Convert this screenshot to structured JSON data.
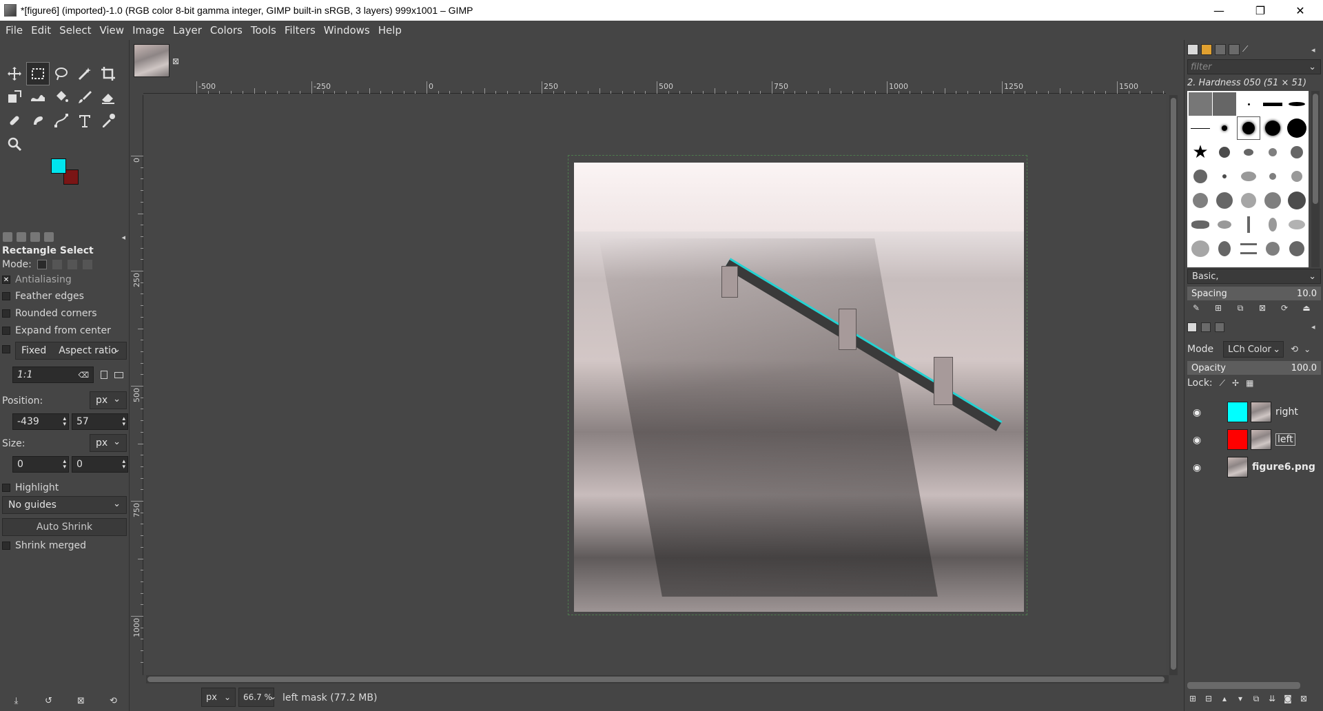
{
  "window": {
    "title": "*[figure6] (imported)-1.0 (RGB color 8-bit gamma integer, GIMP built-in sRGB, 3 layers) 999x1001 – GIMP",
    "minimize": "—",
    "maximize": "❐",
    "close": "✕"
  },
  "menu": [
    "File",
    "Edit",
    "Select",
    "View",
    "Image",
    "Layer",
    "Colors",
    "Tools",
    "Filters",
    "Windows",
    "Help"
  ],
  "colors": {
    "foreground": "#00e5ee",
    "background": "#7a1515"
  },
  "tool_options": {
    "title": "Rectangle Select",
    "mode_label": "Mode:",
    "antialiasing": "Antialiasing",
    "feather_edges": "Feather edges",
    "rounded_corners": "Rounded corners",
    "expand_from_center": "Expand from center",
    "fixed": "Fixed",
    "fixed_mode": "Aspect ratio",
    "ratio": "1:1",
    "position_label": "Position:",
    "position_unit": "px",
    "position_x": "-439",
    "position_y": "57",
    "size_label": "Size:",
    "size_unit": "px",
    "size_w": "0",
    "size_h": "0",
    "highlight": "Highlight",
    "guides": "No guides",
    "auto_shrink": "Auto Shrink",
    "shrink_merged": "Shrink merged"
  },
  "ruler": {
    "h_labels": [
      "-500",
      "-250",
      "0",
      "250",
      "500",
      "750",
      "1000",
      "1250",
      "1500"
    ],
    "v_labels": [
      "0",
      "250",
      "500",
      "750",
      "1000"
    ]
  },
  "status": {
    "unit": "px",
    "zoom": "66.7 %",
    "message": "left mask (77.2 MB)"
  },
  "brushes": {
    "filter_placeholder": "filter",
    "current": "2. Hardness 050 (51 × 51)",
    "preset": "Basic,",
    "spacing_label": "Spacing",
    "spacing_value": "10.0"
  },
  "layers": {
    "mode_label": "Mode",
    "mode_value": "LCh Color",
    "opacity_label": "Opacity",
    "opacity_value": "100.0",
    "lock_label": "Lock:",
    "items": [
      {
        "name": "right",
        "mask_color": "#00ffff",
        "has_mask": true
      },
      {
        "name": "left",
        "mask_color": "#ff0000",
        "has_mask": true
      },
      {
        "name": "figure6.png",
        "has_mask": false
      }
    ]
  }
}
